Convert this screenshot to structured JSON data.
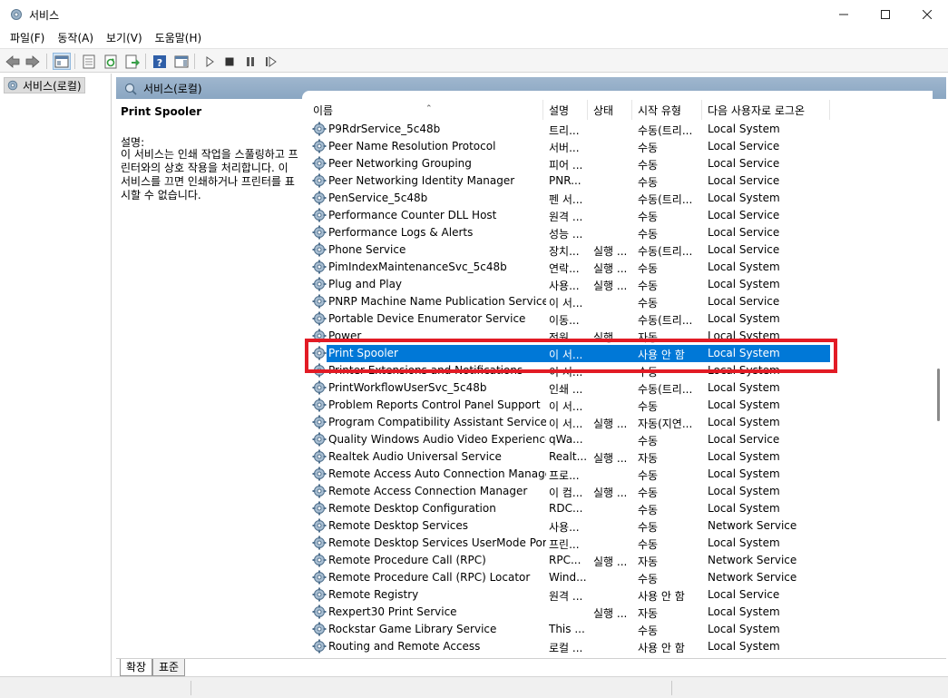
{
  "window": {
    "title": "서비스"
  },
  "menu": [
    "파일(F)",
    "동작(A)",
    "보기(V)",
    "도움말(H)"
  ],
  "tree": {
    "root_label": "서비스(로컬)"
  },
  "panel": {
    "header": "서비스(로컬)"
  },
  "description": {
    "service_name": "Print Spooler",
    "label": "설명:",
    "text": "이 서비스는 인쇄 작업을 스풀링하고 프린터와의 상호 작용을 처리합니다. 이 서비스를 끄면 인쇄하거나 프린터를 표시할 수 없습니다."
  },
  "columns": {
    "name": "이름",
    "description": "설명",
    "status": "상태",
    "startup": "시작 유형",
    "logon": "다음 사용자로 로그온"
  },
  "services": [
    {
      "name": "P9RdrService_5c48b",
      "desc": "트리...",
      "status": "",
      "startup": "수동(트리...",
      "logon": "Local System"
    },
    {
      "name": "Peer Name Resolution Protocol",
      "desc": "서버...",
      "status": "",
      "startup": "수동",
      "logon": "Local Service"
    },
    {
      "name": "Peer Networking Grouping",
      "desc": "피어 ...",
      "status": "",
      "startup": "수동",
      "logon": "Local Service"
    },
    {
      "name": "Peer Networking Identity Manager",
      "desc": "PNR...",
      "status": "",
      "startup": "수동",
      "logon": "Local Service"
    },
    {
      "name": "PenService_5c48b",
      "desc": "펜 서...",
      "status": "",
      "startup": "수동(트리...",
      "logon": "Local System"
    },
    {
      "name": "Performance Counter DLL Host",
      "desc": "원격 ...",
      "status": "",
      "startup": "수동",
      "logon": "Local Service"
    },
    {
      "name": "Performance Logs & Alerts",
      "desc": "성능 ...",
      "status": "",
      "startup": "수동",
      "logon": "Local Service"
    },
    {
      "name": "Phone Service",
      "desc": "장치...",
      "status": "실행 ...",
      "startup": "수동(트리...",
      "logon": "Local Service"
    },
    {
      "name": "PimIndexMaintenanceSvc_5c48b",
      "desc": "연락...",
      "status": "실행 ...",
      "startup": "수동",
      "logon": "Local System"
    },
    {
      "name": "Plug and Play",
      "desc": "사용...",
      "status": "실행 ...",
      "startup": "수동",
      "logon": "Local System"
    },
    {
      "name": "PNRP Machine Name Publication Service",
      "desc": "이 서...",
      "status": "",
      "startup": "수동",
      "logon": "Local Service"
    },
    {
      "name": "Portable Device Enumerator Service",
      "desc": "이동...",
      "status": "",
      "startup": "수동(트리...",
      "logon": "Local System"
    },
    {
      "name": "Power",
      "desc": "전원...",
      "status": "실행 ...",
      "startup": "자동",
      "logon": "Local System"
    },
    {
      "name": "Print Spooler",
      "desc": "이 서...",
      "status": "",
      "startup": "사용 안 함",
      "logon": "Local System",
      "selected": true
    },
    {
      "name": "Printer Extensions and Notifications",
      "desc": "이 서...",
      "status": "",
      "startup": "수동",
      "logon": "Local System"
    },
    {
      "name": "PrintWorkflowUserSvc_5c48b",
      "desc": "인쇄 ...",
      "status": "",
      "startup": "수동(트리...",
      "logon": "Local System"
    },
    {
      "name": "Problem Reports Control Panel Support",
      "desc": "이 서...",
      "status": "",
      "startup": "수동",
      "logon": "Local System"
    },
    {
      "name": "Program Compatibility Assistant Service",
      "desc": "이 서...",
      "status": "실행 ...",
      "startup": "자동(지연...",
      "logon": "Local System"
    },
    {
      "name": "Quality Windows Audio Video Experience",
      "desc": "qWa...",
      "status": "",
      "startup": "수동",
      "logon": "Local Service"
    },
    {
      "name": "Realtek Audio Universal Service",
      "desc": "Realt...",
      "status": "실행 ...",
      "startup": "자동",
      "logon": "Local System"
    },
    {
      "name": "Remote Access Auto Connection Manager",
      "desc": "프로...",
      "status": "",
      "startup": "수동",
      "logon": "Local System"
    },
    {
      "name": "Remote Access Connection Manager",
      "desc": "이 컴...",
      "status": "실행 ...",
      "startup": "수동",
      "logon": "Local System"
    },
    {
      "name": "Remote Desktop Configuration",
      "desc": "RDC...",
      "status": "",
      "startup": "수동",
      "logon": "Local System"
    },
    {
      "name": "Remote Desktop Services",
      "desc": "사용...",
      "status": "",
      "startup": "수동",
      "logon": "Network Service"
    },
    {
      "name": "Remote Desktop Services UserMode Port ...",
      "desc": "프린...",
      "status": "",
      "startup": "수동",
      "logon": "Local System"
    },
    {
      "name": "Remote Procedure Call (RPC)",
      "desc": "RPC...",
      "status": "실행 ...",
      "startup": "자동",
      "logon": "Network Service"
    },
    {
      "name": "Remote Procedure Call (RPC) Locator",
      "desc": "Wind...",
      "status": "",
      "startup": "수동",
      "logon": "Network Service"
    },
    {
      "name": "Remote Registry",
      "desc": "원격 ...",
      "status": "",
      "startup": "사용 안 함",
      "logon": "Local Service"
    },
    {
      "name": "Rexpert30 Print Service",
      "desc": "",
      "status": "실행 ...",
      "startup": "자동",
      "logon": "Local System"
    },
    {
      "name": "Rockstar Game Library Service",
      "desc": "This ...",
      "status": "",
      "startup": "수동",
      "logon": "Local System"
    },
    {
      "name": "Routing and Remote Access",
      "desc": "로컬 ...",
      "status": "",
      "startup": "사용 안 함",
      "logon": "Local System"
    }
  ],
  "tabs": {
    "extended": "확장",
    "standard": "표준"
  },
  "colors": {
    "selection": "#0078d7",
    "highlight_box": "#e21b25",
    "header_bar": "#8aa6c2"
  }
}
